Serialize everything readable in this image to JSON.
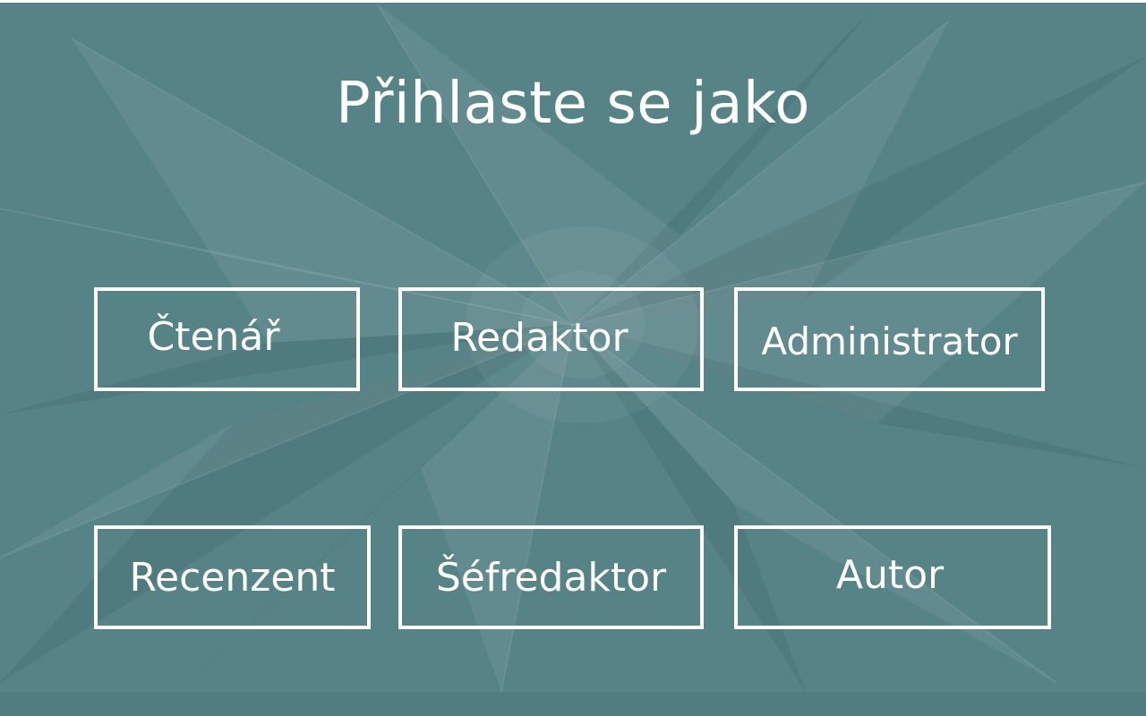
{
  "page": {
    "title": "Přihlaste se jako",
    "background_color": "#558386",
    "text_color": "#ffffff"
  },
  "roles": [
    {
      "label": "Čtenář"
    },
    {
      "label": "Redaktor"
    },
    {
      "label": "Administrator"
    },
    {
      "label": "Recenzent"
    },
    {
      "label": "Šéfredaktor"
    },
    {
      "label": "Autor"
    }
  ]
}
